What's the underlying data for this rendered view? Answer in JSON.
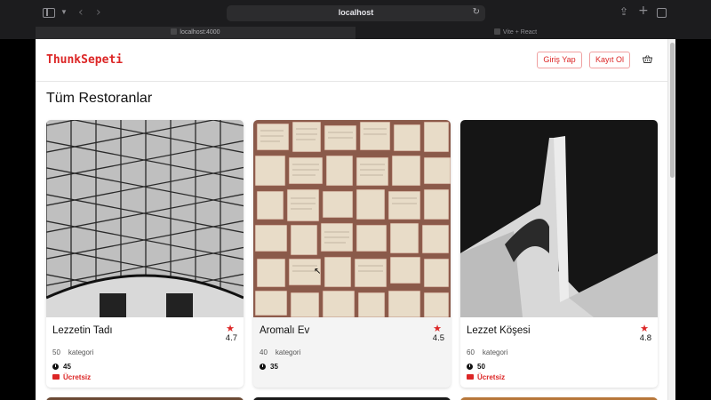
{
  "browser": {
    "url": "localhost",
    "tabs": [
      {
        "label": "localhost:4000",
        "active": true
      },
      {
        "label": "Vite + React",
        "active": false
      }
    ]
  },
  "header": {
    "logo": "ThunkSepeti",
    "login_label": "Giriş Yap",
    "register_label": "Kayıt Ol",
    "basket_icon": "basket-icon"
  },
  "main": {
    "title": "Tüm Restoranlar",
    "restaurants": [
      {
        "name": "Lezzetin Tadı",
        "rating": "4.7",
        "category_count": "50",
        "category_label": "kategori",
        "time": "45",
        "delivery": "Ücretsiz"
      },
      {
        "name": "Aromalı Ev",
        "rating": "4.5",
        "category_count": "40",
        "category_label": "kategori",
        "time": "35",
        "delivery": ""
      },
      {
        "name": "Lezzet Köşesi",
        "rating": "4.8",
        "category_count": "60",
        "category_label": "kategori",
        "time": "50",
        "delivery": "Ücretsiz"
      }
    ]
  },
  "colors": {
    "brand": "#dc2626",
    "chrome": "#1c1c1e"
  }
}
